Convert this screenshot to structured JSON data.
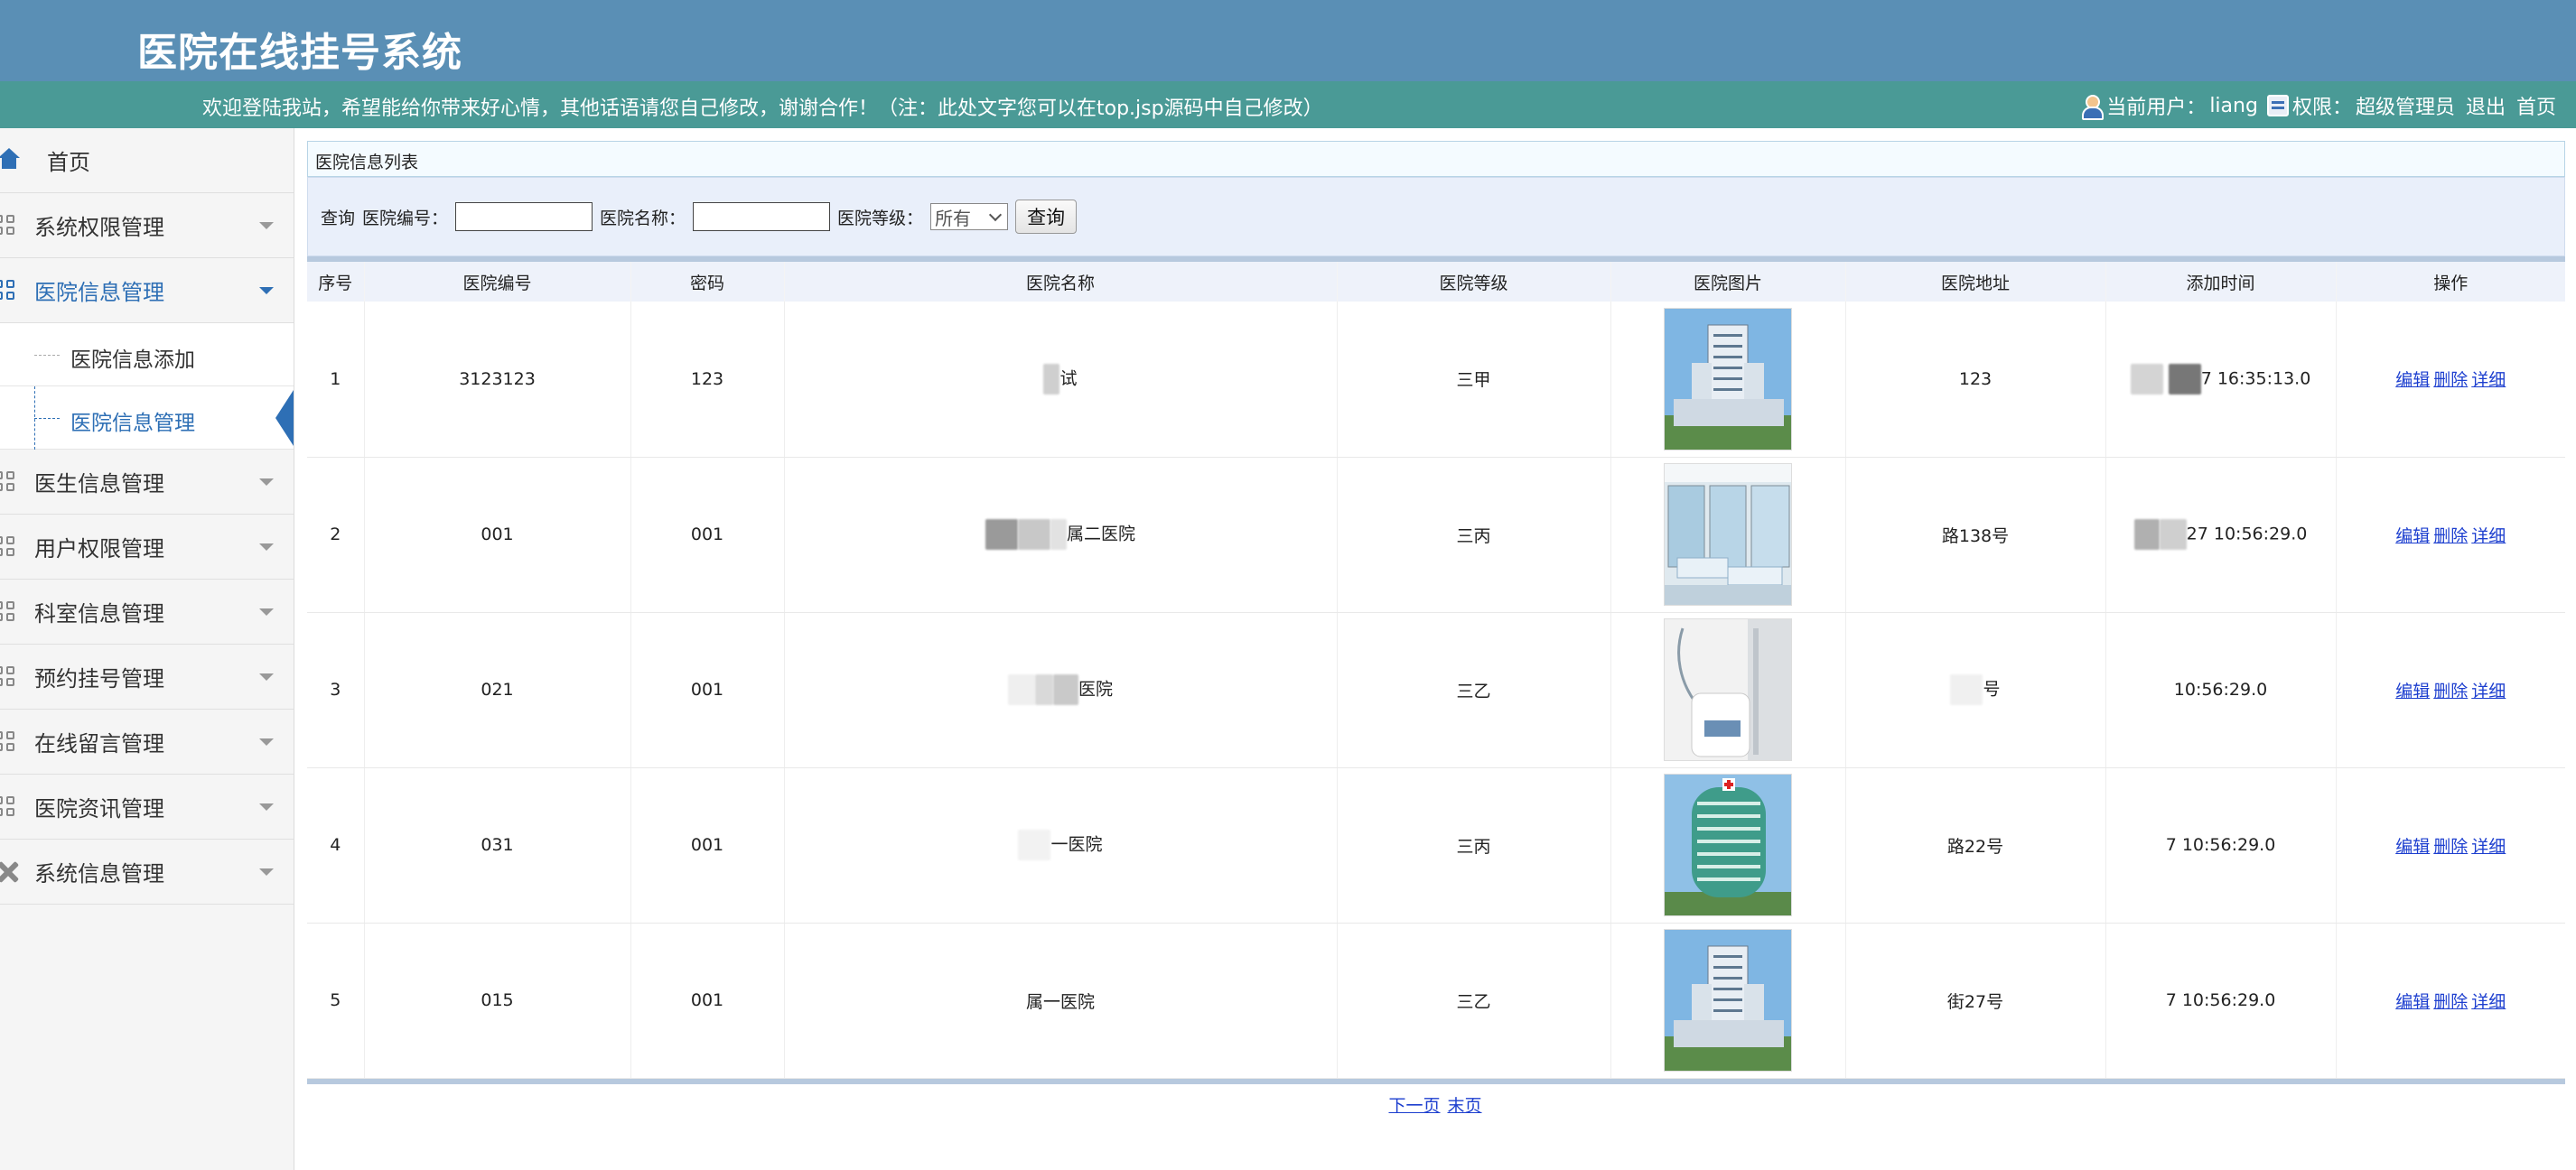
{
  "header": {
    "title": "医院在线挂号系统",
    "welcome": "欢迎登陆我站，希望能给你带来好心情，其他话语请您自己修改，谢谢合作！（注：此处文字您可以在top.jsp源码中自己修改）",
    "user_label": "当前用户：",
    "username": "liang",
    "role_label": "权限：",
    "role": "超级管理员",
    "logout": "退出",
    "home": "首页"
  },
  "sidebar": {
    "home": "首页",
    "items": [
      {
        "label": "系统权限管理"
      },
      {
        "label": "医院信息管理"
      },
      {
        "label": "医生信息管理"
      },
      {
        "label": "用户权限管理"
      },
      {
        "label": "科室信息管理"
      },
      {
        "label": "预约挂号管理"
      },
      {
        "label": "在线留言管理"
      },
      {
        "label": "医院资讯管理"
      },
      {
        "label": "系统信息管理"
      }
    ],
    "sub_items": [
      {
        "label": "医院信息添加"
      },
      {
        "label": "医院信息管理"
      }
    ]
  },
  "panel": {
    "title": "医院信息列表"
  },
  "search": {
    "query_label": "查询",
    "code_label": "医院编号：",
    "code_value": "",
    "name_label": "医院名称：",
    "name_value": "",
    "level_label": "医院等级：",
    "level_selected": "所有",
    "button": "查询"
  },
  "table": {
    "headers": [
      "序号",
      "医院编号",
      "密码",
      "医院名称",
      "医院等级",
      "医院图片",
      "医院地址",
      "添加时间",
      "操作"
    ],
    "rows": [
      {
        "index": "1",
        "code": "3123123",
        "password": "123",
        "name": "试",
        "level": "三甲",
        "image": "hospital-tower-photo",
        "address": "123",
        "time": "7 16:35:13.0"
      },
      {
        "index": "2",
        "code": "001",
        "password": "001",
        "name": "属二医院",
        "level": "三丙",
        "image": "ward-room-photo",
        "address": "路138号",
        "time": "27 10:56:29.0"
      },
      {
        "index": "3",
        "code": "021",
        "password": "001",
        "name": "医院",
        "level": "三乙",
        "image": "doctor-photo",
        "address": "号",
        "time": "10:56:29.0"
      },
      {
        "index": "4",
        "code": "031",
        "password": "001",
        "name": "一医院",
        "level": "三丙",
        "image": "round-hospital-photo",
        "address": "路22号",
        "time": "7 10:56:29.0"
      },
      {
        "index": "5",
        "code": "015",
        "password": "001",
        "name": "属一医院",
        "level": "三乙",
        "image": "hospital-tower-photo",
        "address": "街27号",
        "time": "7 10:56:29.0"
      }
    ],
    "actions": {
      "edit": "编辑",
      "delete": "删除",
      "detail": "详细"
    }
  },
  "pager": {
    "next": "下一页",
    "last": "末页"
  },
  "colors": {
    "header_bg": "#5a8fb5",
    "subbar_bg": "#4a9a96",
    "accent": "#2e6fb5",
    "link": "#1d3fcf"
  }
}
